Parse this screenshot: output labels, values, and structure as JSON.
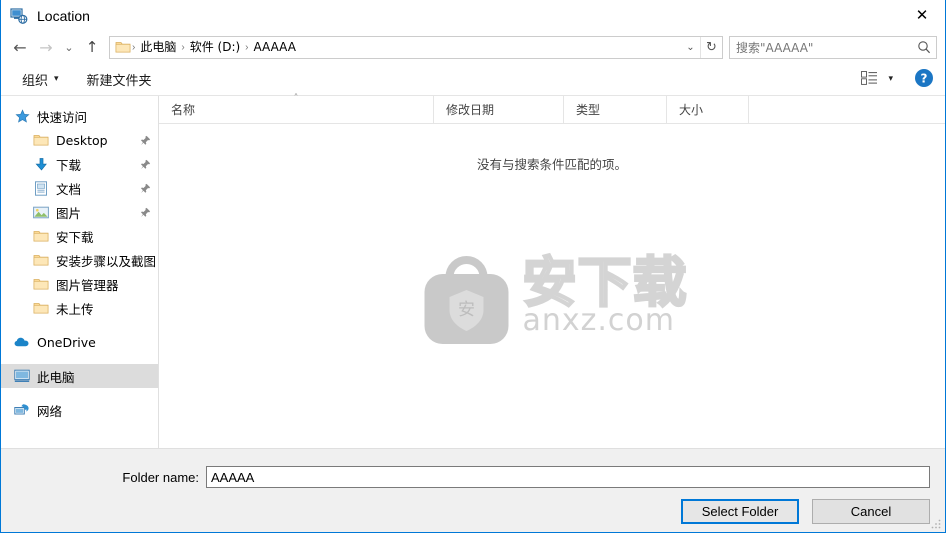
{
  "window": {
    "title": "Location",
    "title_icon": "network-computer-icon",
    "close_label": "✕"
  },
  "nav": {
    "back_icon": "←",
    "forward_icon": "→",
    "recent_icon": "⌄",
    "up_icon": "↑",
    "back_name": "back-button",
    "forward_name": "forward-button",
    "recent_name": "recent-locations-button",
    "up_name": "up-button"
  },
  "address": {
    "folder_icon": "folder-icon",
    "separator": "›",
    "crumbs": [
      {
        "label": "此电脑"
      },
      {
        "label": "软件 (D:)"
      },
      {
        "label": "AAAAA"
      }
    ],
    "dropdown_icon": "⌄",
    "refresh_icon": "↻"
  },
  "search": {
    "placeholder": "搜索\"AAAAA\"",
    "icon": "search-icon"
  },
  "toolbar": {
    "organize_label": "组织",
    "organize_caret": "▾",
    "new_folder_label": "新建文件夹",
    "view_icon": "view-layout-icon",
    "view_caret": "▾",
    "help_label": "?"
  },
  "sidebar": {
    "groups": [
      {
        "name": "quick-access",
        "label": "快速访问",
        "icon": "star-icon",
        "items": [
          {
            "label": "Desktop",
            "icon": "folder-icon",
            "pinned": true
          },
          {
            "label": "下载",
            "icon": "download-icon",
            "pinned": true
          },
          {
            "label": "文档",
            "icon": "documents-icon",
            "pinned": true
          },
          {
            "label": "图片",
            "icon": "pictures-icon",
            "pinned": true
          },
          {
            "label": "安下载",
            "icon": "folder-icon",
            "pinned": false
          },
          {
            "label": "安装步骤以及截图",
            "icon": "folder-icon",
            "pinned": false
          },
          {
            "label": "图片管理器",
            "icon": "folder-icon",
            "pinned": false
          },
          {
            "label": "未上传",
            "icon": "folder-icon",
            "pinned": false
          }
        ]
      }
    ],
    "roots": [
      {
        "label": "OneDrive",
        "icon": "cloud-icon",
        "selected": false
      },
      {
        "label": "此电脑",
        "icon": "computer-icon",
        "selected": true
      },
      {
        "label": "网络",
        "icon": "network-icon",
        "selected": false
      }
    ]
  },
  "filelist": {
    "columns": [
      {
        "label": "名称",
        "sorted": true,
        "sort_caret": "˄"
      },
      {
        "label": "修改日期",
        "sorted": false
      },
      {
        "label": "类型",
        "sorted": false
      },
      {
        "label": "大小",
        "sorted": false
      }
    ],
    "empty_message": "没有与搜索条件匹配的项。",
    "watermark": {
      "logo_icon": "anxz-bag-logo",
      "badge_text": "安",
      "cn_text": "安下载",
      "domain_text": "anxz.com"
    }
  },
  "footer": {
    "folder_name_label": "Folder name:",
    "folder_name_value": "AAAAA",
    "select_button": "Select Folder",
    "cancel_button": "Cancel"
  },
  "colors": {
    "accent": "#0078d7",
    "panel": "#f0f0f0",
    "selection": "#dcdcdc",
    "watermark": "#d4d4d4"
  }
}
